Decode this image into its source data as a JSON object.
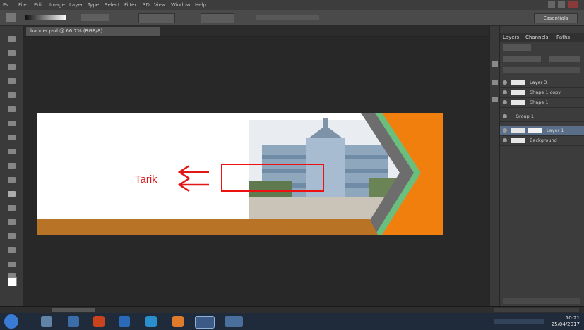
{
  "app": {
    "menu": [
      "Ps",
      "File",
      "Edit",
      "Image",
      "Layer",
      "Type",
      "Select",
      "Filter",
      "3D",
      "View",
      "Window",
      "Help"
    ],
    "workspace_label": "Essentials"
  },
  "document": {
    "tab_title": "banner.psd @ 66.7% (RGB/8)",
    "colors": {
      "orange": "#f07f0e",
      "stripe": "#b97326",
      "green": "#6abf7e",
      "gray": "#6d6d6d"
    }
  },
  "annotation": {
    "label": "Tarik",
    "arrow_glyph": "⇐",
    "color": "#e01818"
  },
  "panels": {
    "tabs": [
      "Layers",
      "Channels",
      "Paths"
    ],
    "layers": [
      "Layer 3",
      "Shape 1 copy",
      "Shape 1",
      "Group 1",
      "Layer 1",
      "Background"
    ]
  },
  "taskbar": {
    "clock_time": "10:21",
    "clock_date": "25/04/2017"
  }
}
